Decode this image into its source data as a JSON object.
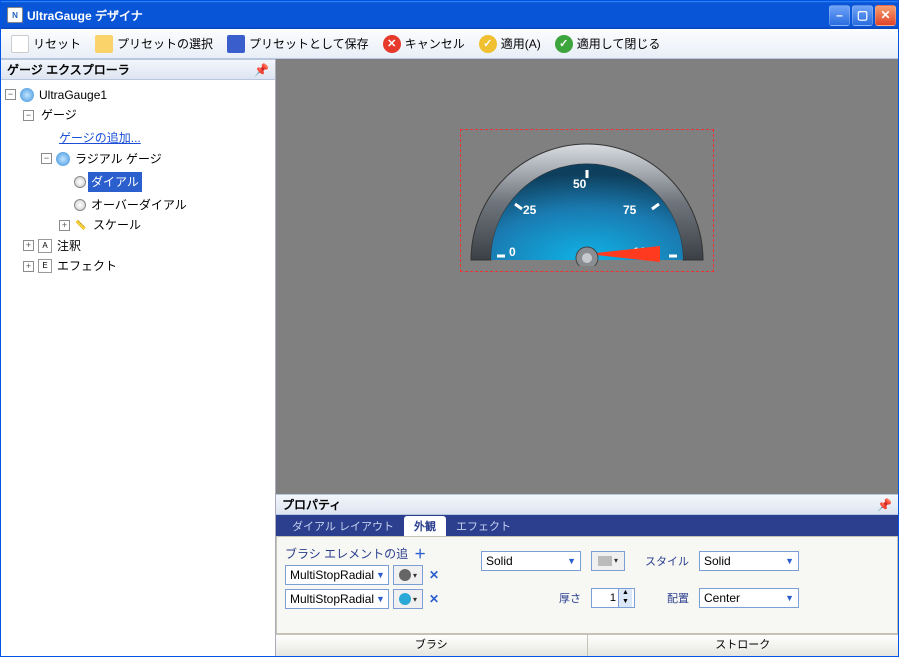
{
  "title": "UltraGauge デザイナ",
  "toolbar": {
    "reset": "リセット",
    "open": "プリセットの選択",
    "save": "プリセットとして保存",
    "cancel": "キャンセル",
    "apply": "適用(A)",
    "applyClose": "適用して閉じる"
  },
  "explorer": {
    "header": "ゲージ エクスプローラ",
    "root": "UltraGauge1",
    "gauges": "ゲージ",
    "addGauge": "ゲージの追加...",
    "radialGauge": "ラジアル ゲージ",
    "dial": "ダイアル",
    "overDial": "オーバーダイアル",
    "scale": "スケール",
    "annotations": "注釈",
    "effects": "エフェクト"
  },
  "gauge": {
    "ticks": [
      "0",
      "25",
      "50",
      "75",
      "100"
    ]
  },
  "props": {
    "header": "プロパティ",
    "tabs": {
      "layout": "ダイアル レイアウト",
      "appearance": "外観",
      "effects": "エフェクト"
    },
    "brush": {
      "header": "ブラシ エレメントの追",
      "rows": [
        {
          "type": "MultiStopRadial",
          "color": "#666666"
        },
        {
          "type": "MultiStopRadial",
          "color": "#2aa8d8"
        }
      ]
    },
    "stroke": {
      "styleSel": "Solid",
      "thicknessLabel": "厚さ",
      "thickness": "1",
      "styleLabel": "スタイル",
      "styleVal": "Solid",
      "alignLabel": "配置",
      "alignVal": "Center"
    },
    "bottomTabs": {
      "brush": "ブラシ",
      "stroke": "ストローク"
    }
  }
}
